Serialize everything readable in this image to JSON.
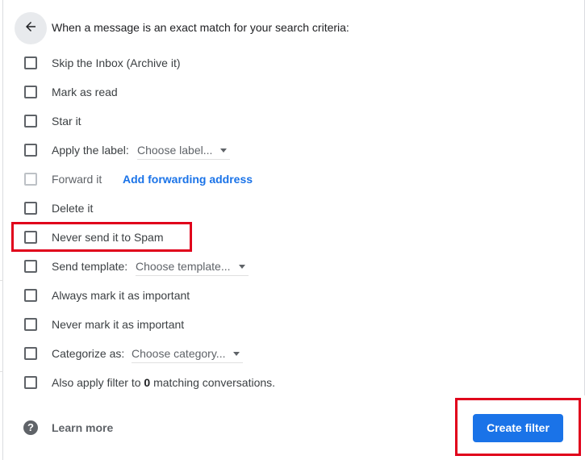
{
  "header": {
    "title": "When a message is an exact match for your search criteria:",
    "back_icon": "arrow-left-icon"
  },
  "options": [
    {
      "label": "Skip the Inbox (Archive it)",
      "checked": false
    },
    {
      "label": "Mark as read",
      "checked": false
    },
    {
      "label": "Star it",
      "checked": false
    },
    {
      "label": "Apply the label:",
      "checked": false,
      "dropdown": "Choose label..."
    },
    {
      "label": "Forward it",
      "checked": false,
      "disabled": true,
      "link": "Add forwarding address"
    },
    {
      "label": "Delete it",
      "checked": false
    },
    {
      "label": "Never send it to Spam",
      "checked": false,
      "highlighted": true
    },
    {
      "label": "Send template:",
      "checked": false,
      "dropdown": "Choose template..."
    },
    {
      "label": "Always mark it as important",
      "checked": false
    },
    {
      "label": "Never mark it as important",
      "checked": false
    },
    {
      "label": "Categorize as:",
      "checked": false,
      "dropdown": "Choose category..."
    },
    {
      "label_prefix": "Also apply filter to ",
      "count": "0",
      "label_suffix": " matching conversations.",
      "checked": false
    }
  ],
  "footer": {
    "help_icon": "question-circle-icon",
    "help_glyph": "?",
    "learn_more": "Learn more",
    "create_filter": "Create filter"
  },
  "colors": {
    "primary": "#1a73e8",
    "highlight": "#e0001b"
  }
}
